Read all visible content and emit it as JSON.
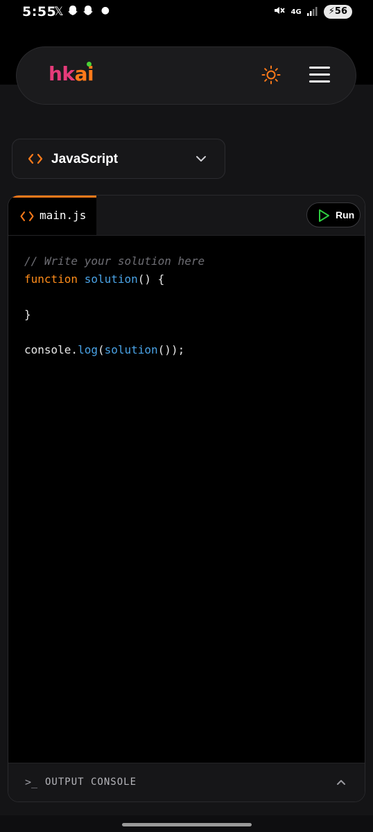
{
  "status_bar": {
    "time": "5:55",
    "notification_icons": [
      "x-icon",
      "snapchat-icon",
      "snapchat-icon",
      "dot-icon"
    ],
    "network": "4G",
    "battery": "56"
  },
  "header": {
    "logo_part1": "hk",
    "logo_part2": "ai",
    "brand_colors": {
      "pink": "#e63b7a",
      "orange": "#ff7a1a",
      "green_dot": "#4cd137"
    },
    "theme_icon": "sun-icon",
    "menu_icon": "hamburger-menu-icon"
  },
  "language_select": {
    "selected": "JavaScript",
    "icon": "code-icon",
    "chevron": "chevron-down-icon"
  },
  "editor": {
    "tab_label": "main.js",
    "run_label": "Run",
    "code_lines": [
      [
        {
          "t": "// Write your solution here",
          "k": "comment"
        }
      ],
      [
        {
          "t": "function",
          "k": "kw"
        },
        {
          "t": " ",
          "k": "plain"
        },
        {
          "t": "solution",
          "k": "fn"
        },
        {
          "t": "() {",
          "k": "plain"
        }
      ],
      [],
      [
        {
          "t": "}",
          "k": "plain"
        }
      ],
      [],
      [
        {
          "t": "console.",
          "k": "plain"
        },
        {
          "t": "log",
          "k": "fn"
        },
        {
          "t": "(",
          "k": "plain"
        },
        {
          "t": "solution",
          "k": "fn"
        },
        {
          "t": "());",
          "k": "plain"
        }
      ]
    ]
  },
  "console": {
    "prompt": ">_",
    "label": "OUTPUT CONSOLE",
    "toggle_icon": "chevron-up-icon"
  }
}
